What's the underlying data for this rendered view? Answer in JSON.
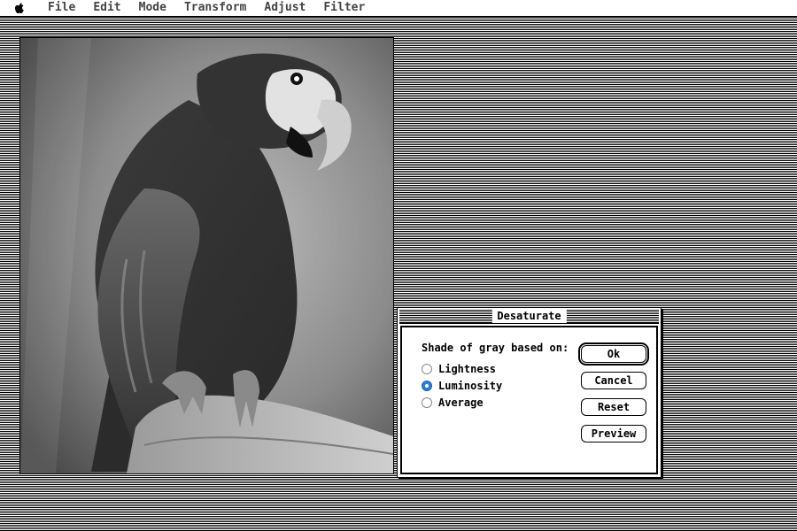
{
  "menubar": {
    "apple_icon": "apple-logo-icon",
    "items": [
      "File",
      "Edit",
      "Mode",
      "Transform",
      "Adjust",
      "Filter"
    ]
  },
  "document": {
    "image_subject_icon": "macaw-photo-grayscale"
  },
  "dialog": {
    "title": "Desaturate",
    "group_label": "Shade of gray based on:",
    "options": [
      {
        "label": "Lightness",
        "selected": false
      },
      {
        "label": "Luminosity",
        "selected": true
      },
      {
        "label": "Average",
        "selected": false
      }
    ],
    "buttons": {
      "ok": "Ok",
      "cancel": "Cancel",
      "reset": "Reset",
      "preview": "Preview"
    },
    "accent_color": "#2d7ed6"
  }
}
